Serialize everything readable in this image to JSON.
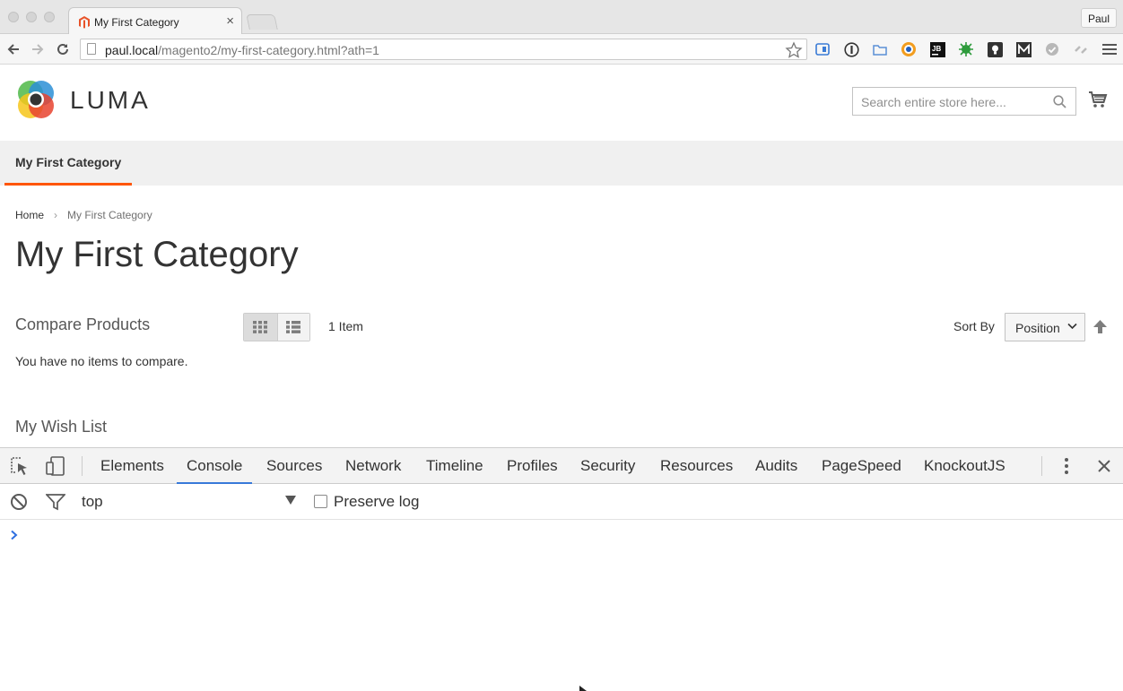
{
  "browser": {
    "tab_title": "My First Category",
    "tab_close": "×",
    "profile_name": "Paul",
    "url_host": "paul.local",
    "url_path": "/magento2/my-first-category.html?ath=1"
  },
  "header": {
    "logo_text": "LUMA",
    "search_placeholder": "Search entire store here..."
  },
  "nav": {
    "items": [
      {
        "label": "My First Category"
      }
    ]
  },
  "breadcrumb": {
    "home": "Home",
    "separator": "›",
    "current": "My First Category"
  },
  "main": {
    "title": "My First Category",
    "item_count": "1 Item",
    "sort_label": "Sort By",
    "sort_value": "Position"
  },
  "sidebar": {
    "compare_title": "Compare Products",
    "compare_empty": "You have no items to compare.",
    "wishlist_title": "My Wish List"
  },
  "devtools": {
    "tabs": [
      {
        "label": "Elements"
      },
      {
        "label": "Console"
      },
      {
        "label": "Sources"
      },
      {
        "label": "Network"
      },
      {
        "label": "Timeline"
      },
      {
        "label": "Profiles"
      },
      {
        "label": "Security"
      },
      {
        "label": "Resources"
      },
      {
        "label": "Audits"
      },
      {
        "label": "PageSpeed"
      },
      {
        "label": "KnockoutJS"
      }
    ],
    "active_tab": "Console",
    "context": "top",
    "preserve_log_label": "Preserve log",
    "preserve_log_checked": false,
    "prompt": "›"
  },
  "colors": {
    "accent": "#ff5501",
    "devtools_active": "#3879d9"
  }
}
